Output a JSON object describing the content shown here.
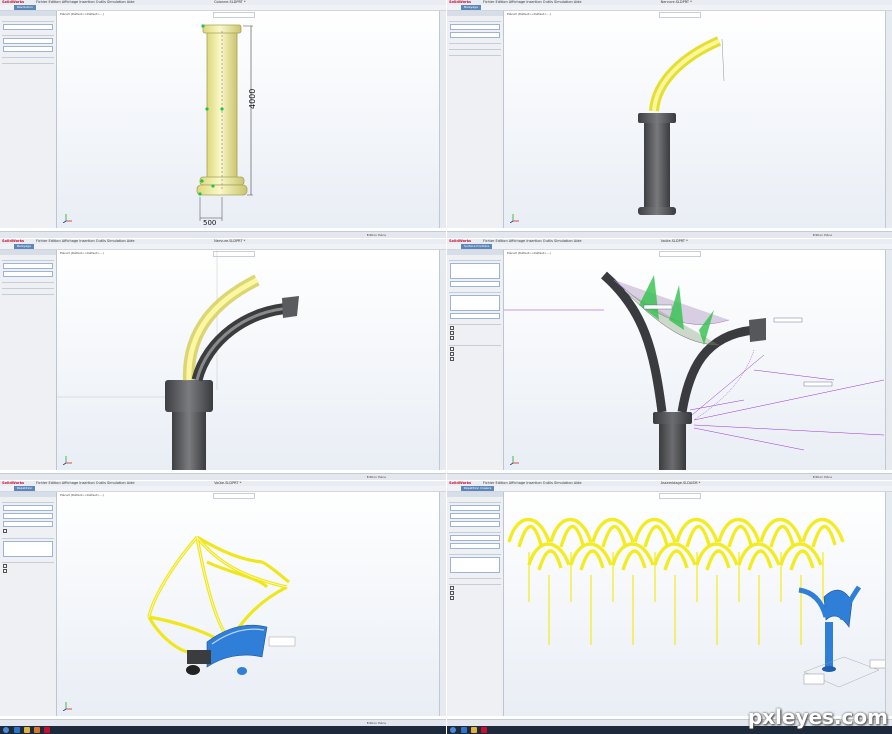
{
  "app": {
    "logo_text": "SolidWorks",
    "menu_items": "Fichier  Edition  Affichage  Insertion  Outils  Simulation  Aide"
  },
  "panels": [
    {
      "doc_title": "Colonne.SLDPRT *",
      "tab": "Esquisse",
      "pm_title": "Révolution",
      "viewport_label": "Pièce3 (Défaut<<Défaut>...)",
      "status": "Edition Pièce",
      "dimensions": [
        "4000",
        "500"
      ]
    },
    {
      "doc_title": "Nervure.SLDPRT *",
      "tab": "Esquisse",
      "pm_title": "Balayage",
      "viewport_label": "Pièce3 (Défaut<<Défaut>...)",
      "status": "Edition Pièce"
    },
    {
      "doc_title": "Nervure.SLDPRT *",
      "tab": "Fonctions",
      "pm_title": "Balayage",
      "viewport_label": "Pièce3 (Défaut<<Défaut>...)",
      "status": "Edition Pièce"
    },
    {
      "doc_title": "Voûte.SLDPRT *",
      "tab": "Esquisse",
      "pm_title": "Surface frontière",
      "viewport_label": "Pièce3 (Défaut<<Défaut>...)",
      "status": "Edition Pièce"
    },
    {
      "doc_title": "Voûte.SLDPRT *",
      "tab": "Fonctions",
      "pm_title": "Répétition",
      "viewport_label": "Pièce3 (Défaut<<Défaut>...)",
      "status": "Edition Pièce"
    },
    {
      "doc_title": "Assemblage.SLDASM *",
      "tab": "Fonctions",
      "pm_title": "Répétition linéaire",
      "viewport_label": "",
      "status": "Edition Pièce"
    }
  ],
  "watermark": "pxleyes.com",
  "colors": {
    "accent": "#5d87b8",
    "preview": "#f5f100",
    "column": "#4d4f52",
    "column_selected": "#f3f1a6",
    "curve": "#9b30d9",
    "surface_blue": "#2f7fd8"
  }
}
